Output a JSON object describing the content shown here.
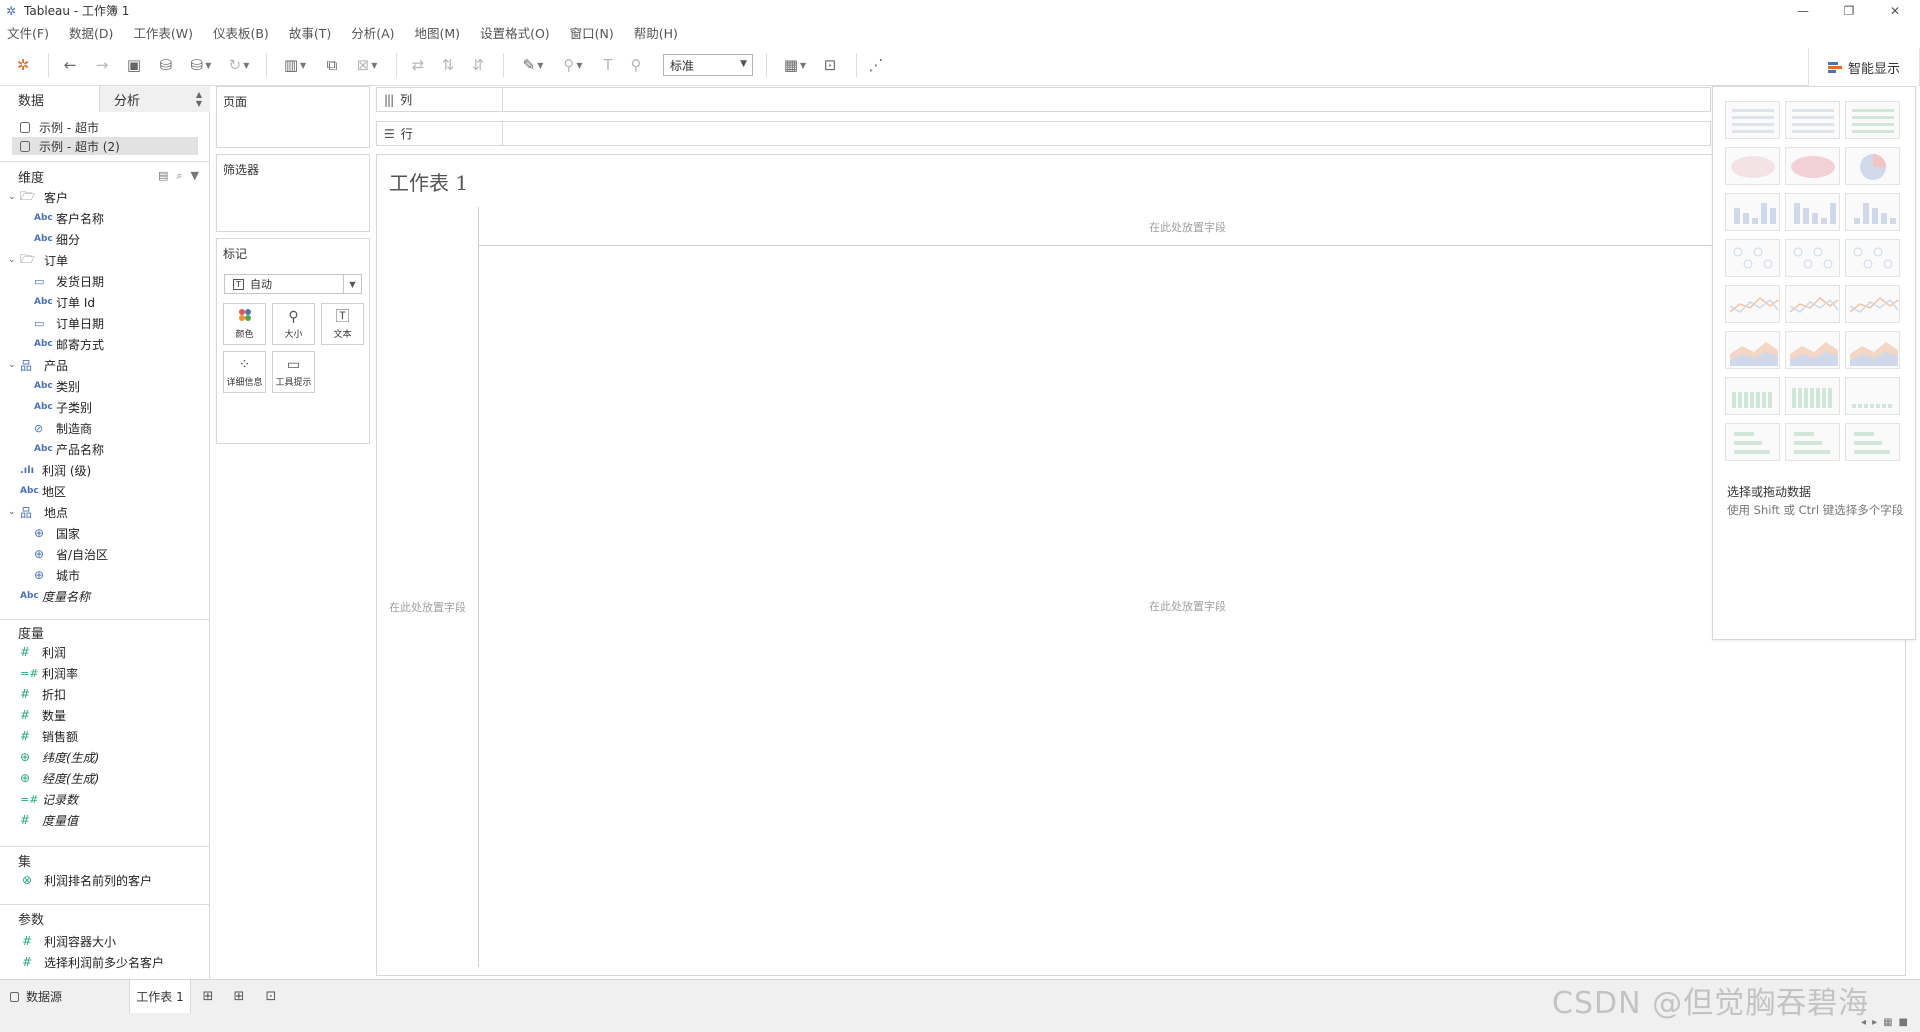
{
  "window": {
    "title": "Tableau - 工作簿 1"
  },
  "menu": [
    "文件(F)",
    "数据(D)",
    "工作表(W)",
    "仪表板(B)",
    "故事(T)",
    "分析(A)",
    "地图(M)",
    "设置格式(O)",
    "窗口(N)",
    "帮助(H)"
  ],
  "toolbar": {
    "fit_value": "标准",
    "smart_show_label": "智能显示"
  },
  "left_panel": {
    "tabs": {
      "data": "数据",
      "analysis": "分析"
    },
    "datasources": [
      "示例 - 超市",
      "示例 - 超市 (2)"
    ],
    "dimensions_header": "维度",
    "dimensions": [
      {
        "label": "客户",
        "type": "folder",
        "level": 0
      },
      {
        "label": "客户名称",
        "type": "Abc",
        "level": 1
      },
      {
        "label": "细分",
        "type": "Abc",
        "level": 1
      },
      {
        "label": "订单",
        "type": "folder",
        "level": 0
      },
      {
        "label": "发货日期",
        "type": "date",
        "level": 1
      },
      {
        "label": "订单 Id",
        "type": "Abc",
        "level": 1
      },
      {
        "label": "订单日期",
        "type": "date",
        "level": 1
      },
      {
        "label": "邮寄方式",
        "type": "Abc",
        "level": 1
      },
      {
        "label": "产品",
        "type": "hierarchy",
        "level": 0
      },
      {
        "label": "类别",
        "type": "Abc",
        "level": 1
      },
      {
        "label": "子类别",
        "type": "Abc",
        "level": 1
      },
      {
        "label": "制造商",
        "type": "link",
        "level": 1
      },
      {
        "label": "产品名称",
        "type": "Abc",
        "level": 1
      },
      {
        "label": "利润 (级)",
        "type": "bin",
        "level": 0
      },
      {
        "label": "地区",
        "type": "Abc",
        "level": 0
      },
      {
        "label": "地点",
        "type": "hierarchy",
        "level": 0
      },
      {
        "label": "国家",
        "type": "geo",
        "level": 1
      },
      {
        "label": "省/自治区",
        "type": "geo",
        "level": 1
      },
      {
        "label": "城市",
        "type": "geo",
        "level": 1
      },
      {
        "label": "度量名称",
        "type": "Abc",
        "level": 0,
        "italic": true
      }
    ],
    "measures_header": "度量",
    "measures": [
      {
        "label": "利润",
        "type": "#"
      },
      {
        "label": "利润率",
        "type": "=#"
      },
      {
        "label": "折扣",
        "type": "#"
      },
      {
        "label": "数量",
        "type": "#"
      },
      {
        "label": "销售额",
        "type": "#"
      },
      {
        "label": "纬度(生成)",
        "type": "geo",
        "italic": true
      },
      {
        "label": "经度(生成)",
        "type": "geo",
        "italic": true
      },
      {
        "label": "记录数",
        "type": "=#",
        "italic": true
      },
      {
        "label": "度量值",
        "type": "#",
        "italic": true
      }
    ],
    "sets_header": "集",
    "sets": [
      {
        "label": "利润排名前列的客户"
      }
    ],
    "params_header": "参数",
    "params": [
      {
        "label": "利润容器大小"
      },
      {
        "label": "选择利润前多少名客户"
      }
    ]
  },
  "shelves": {
    "pages": "页面",
    "filters": "筛选器",
    "marks": "标记",
    "marks_type": "自动",
    "mark_buttons": [
      "颜色",
      "大小",
      "文本",
      "详细信息",
      "工具提示"
    ],
    "columns": "列",
    "rows": "行"
  },
  "sheet": {
    "title": "工作表 1",
    "drop_hint": "在此处放置字段"
  },
  "showme": {
    "hint_title": "选择或拖动数据",
    "hint_text": "使用 Shift 或 Ctrl 键选择多个字段"
  },
  "bottom": {
    "datasource_tab": "数据源",
    "sheet_tab": "工作表 1"
  },
  "watermark": "CSDN @但觉胸吞碧海",
  "colors": {
    "accent_blue": "#4a73b7",
    "measure_green": "#2aa879"
  }
}
